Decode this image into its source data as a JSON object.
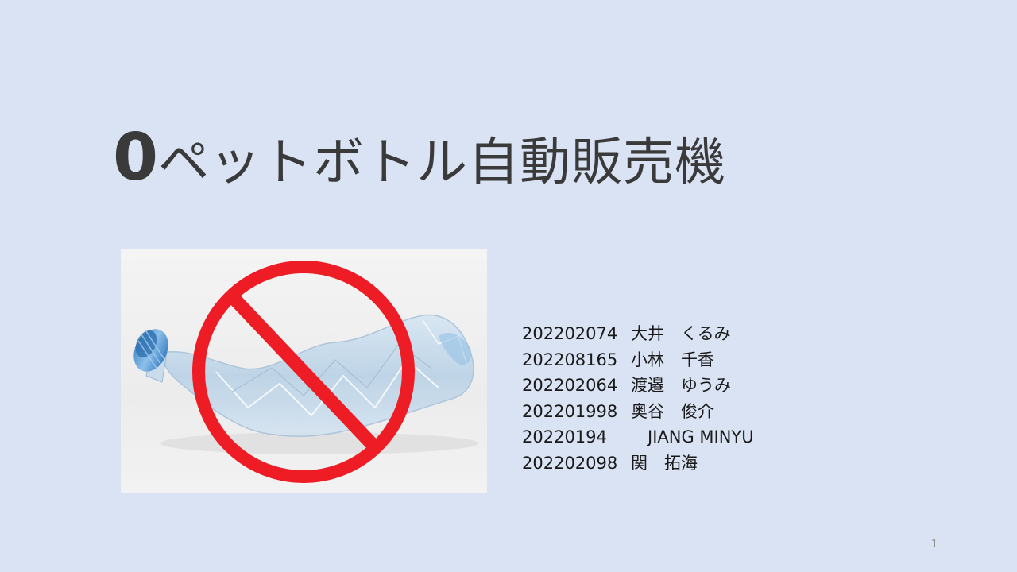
{
  "slide": {
    "title_prefix": "0",
    "title_text": "ペットボトル自動販売機",
    "page_number": "1"
  },
  "members": [
    {
      "id": "202202074",
      "name": "大井　くるみ"
    },
    {
      "id": "202208165",
      "name": "小林　千香"
    },
    {
      "id": "202202064",
      "name": "渡邉　ゆうみ"
    },
    {
      "id": "202201998",
      "name": "奥谷　俊介"
    },
    {
      "id": "20220194",
      "name": "　JIANG MINYU"
    },
    {
      "id": "202202098",
      "name": "関　拓海"
    }
  ],
  "colors": {
    "background": "#dae3f3",
    "prohibition_red": "#ee1c25",
    "bottle_blue": "#5b9fd6",
    "photo_background": "#eeeeee"
  },
  "icons": {
    "photo": "crushed-plastic-bottle-image",
    "overlay": "prohibition-sign-icon"
  }
}
